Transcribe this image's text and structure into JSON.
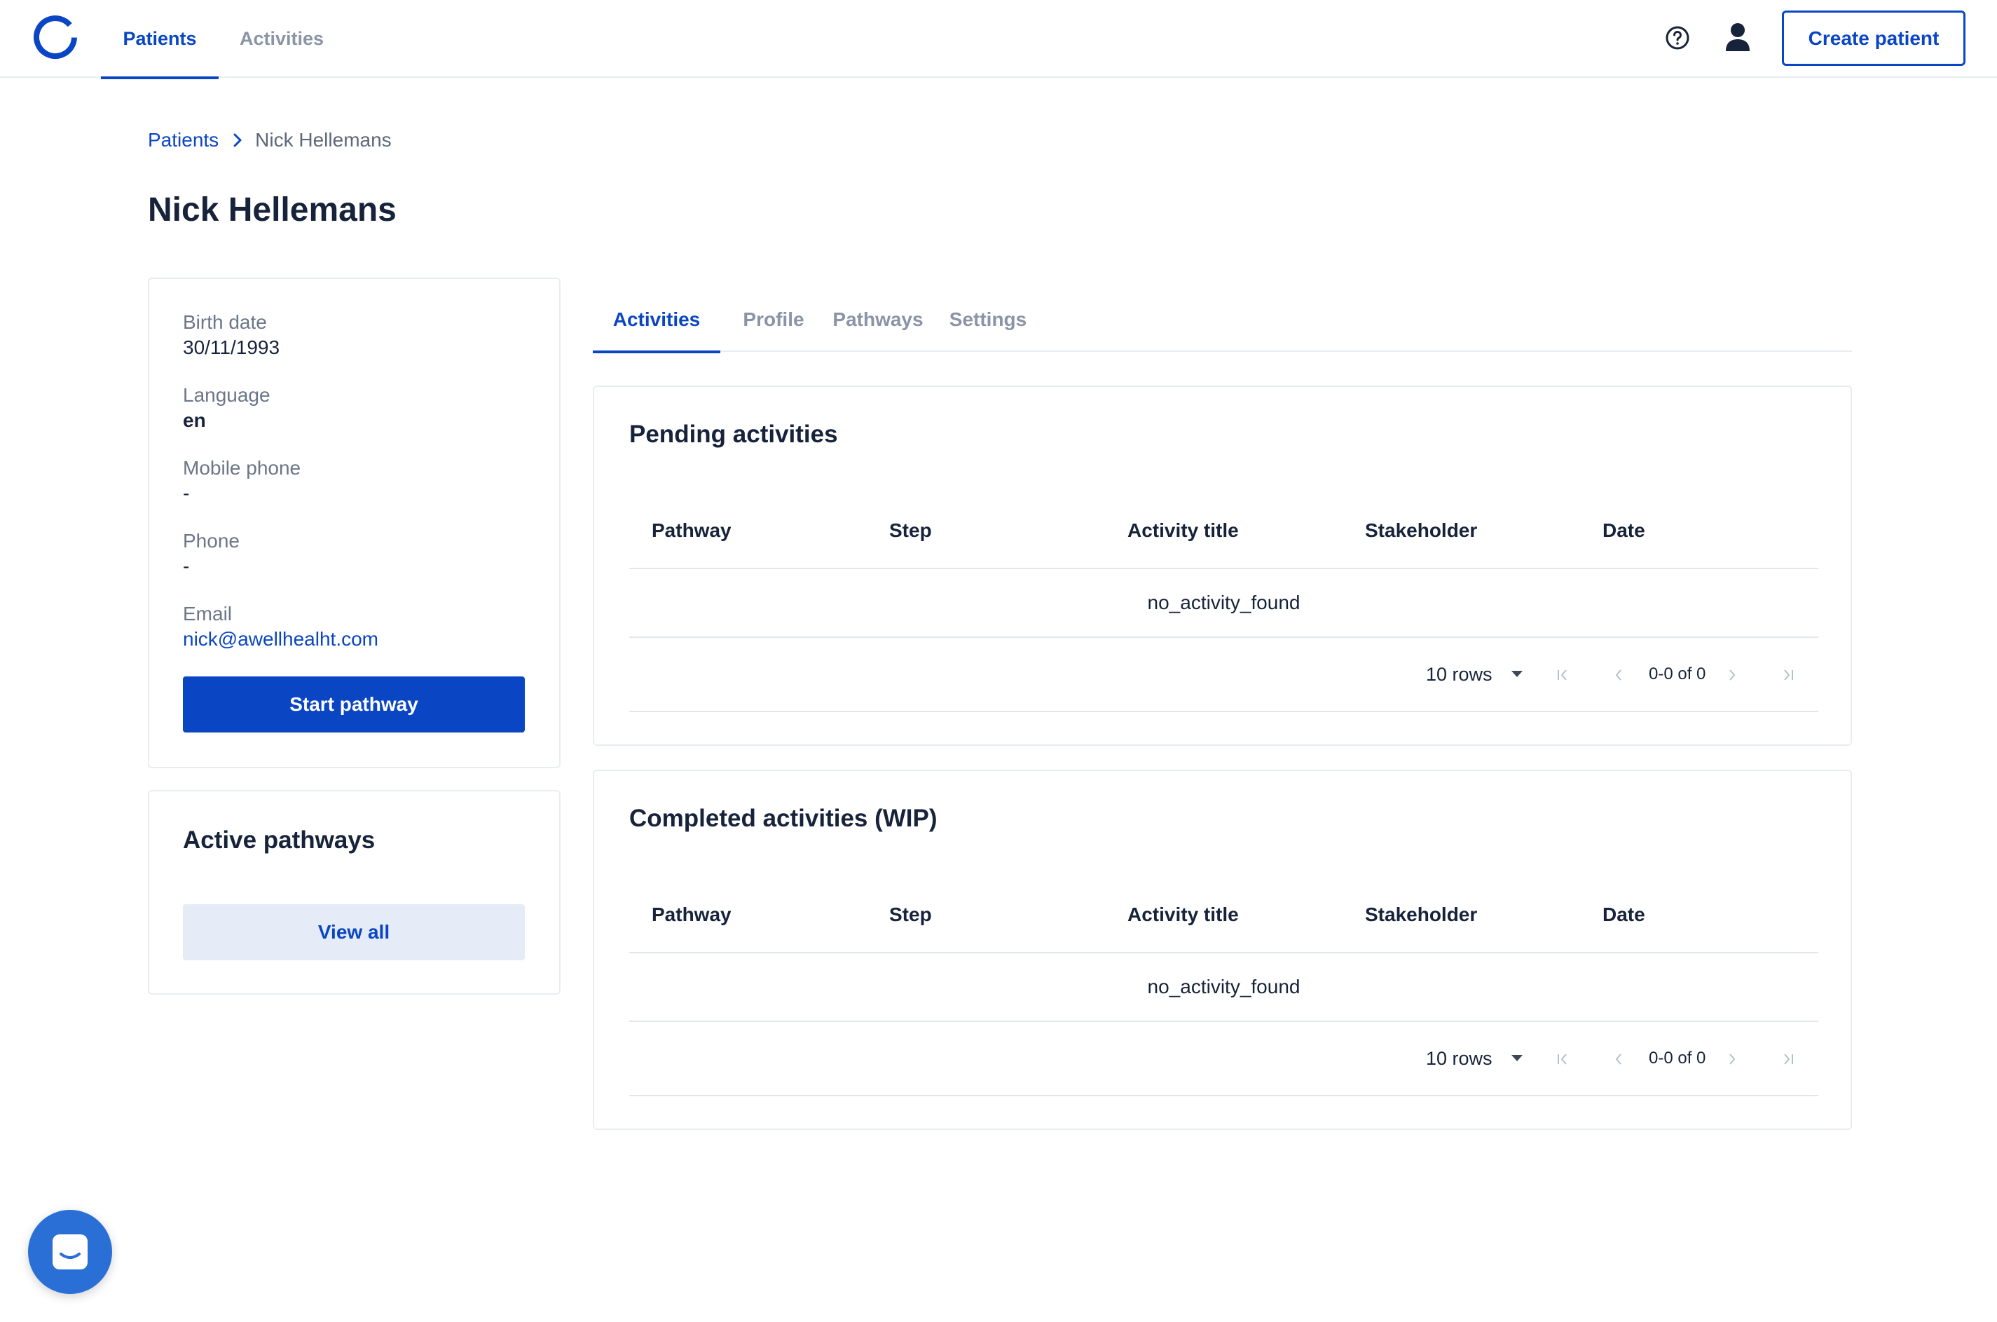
{
  "nav": {
    "tabs": [
      {
        "label": "Patients",
        "active": true
      },
      {
        "label": "Activities",
        "active": false
      }
    ],
    "create_button": "Create patient",
    "icons": [
      "logo-icon",
      "help-icon",
      "user-icon"
    ]
  },
  "breadcrumb": {
    "parent": "Patients",
    "current": "Nick Hellemans"
  },
  "page_title": "Nick Hellemans",
  "patient_info": {
    "fields": [
      {
        "label": "Birth date",
        "value": "30/11/1993"
      },
      {
        "label": "Language",
        "value": "en"
      },
      {
        "label": "Mobile phone",
        "value": "-"
      },
      {
        "label": "Phone",
        "value": "-"
      },
      {
        "label": "Email",
        "value": "nick@awellhealht.com"
      }
    ],
    "start_button": "Start pathway"
  },
  "active_pathways": {
    "title": "Active pathways",
    "view_all_button": "View all"
  },
  "tabs": [
    {
      "label": "Activities",
      "active": true
    },
    {
      "label": "Profile",
      "active": false
    },
    {
      "label": "Pathways",
      "active": false
    },
    {
      "label": "Settings",
      "active": false
    }
  ],
  "panels": [
    {
      "title": "Pending activities",
      "columns": [
        "Pathway",
        "Step",
        "Activity title",
        "Stakeholder",
        "Date"
      ],
      "empty_text": "no_activity_found",
      "rows_per_page": "10 rows",
      "range": "0-0 of 0"
    },
    {
      "title": "Completed activities (WIP)",
      "columns": [
        "Pathway",
        "Step",
        "Activity title",
        "Stakeholder",
        "Date"
      ],
      "empty_text": "no_activity_found",
      "rows_per_page": "10 rows",
      "range": "0-0 of 0"
    }
  ],
  "colors": {
    "primary": "#0a46c4",
    "text_dark": "#16233a",
    "text_muted": "#8a94a6",
    "border": "#e9edf2",
    "secondary_button_bg": "#e5ebf7",
    "chat_button": "#2a6fd6"
  }
}
